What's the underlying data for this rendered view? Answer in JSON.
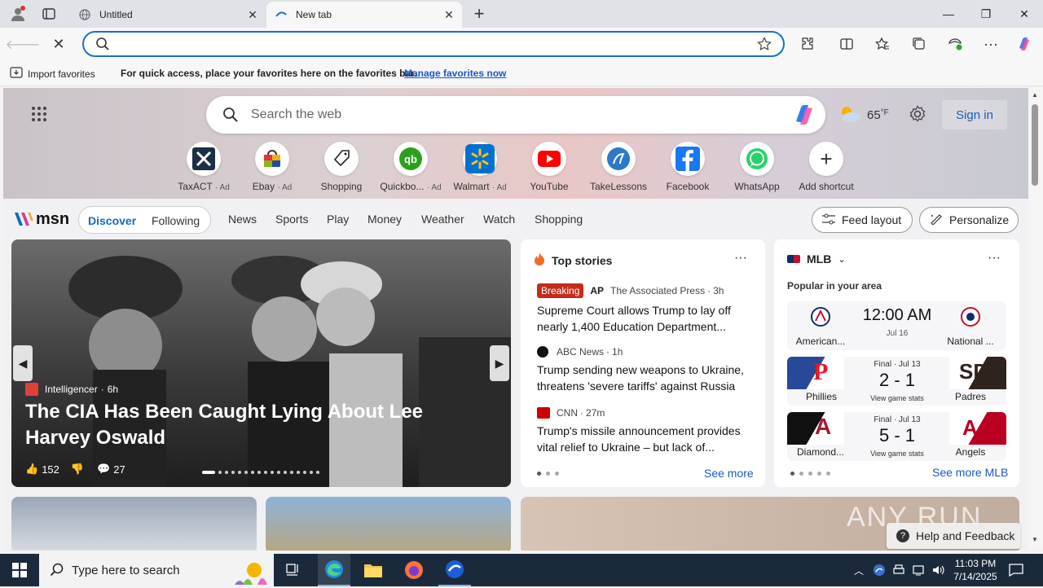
{
  "tabs": [
    {
      "label": "Untitled"
    },
    {
      "label": "New tab"
    }
  ],
  "favorites_bar": {
    "import_label": "Import favorites",
    "message": "For quick access, place your favorites here on the favorites bar.",
    "manage_link": "Manage favorites now"
  },
  "hero": {
    "search_placeholder": "Search the web",
    "temperature": "65",
    "temp_unit": "°F",
    "sign_in": "Sign in",
    "quick_links": [
      {
        "label": "TaxACT",
        "ad": "· Ad",
        "icon": "taxact-icon"
      },
      {
        "label": "Ebay",
        "ad": "· Ad",
        "icon": "ebay-icon"
      },
      {
        "label": "Shopping",
        "ad": "",
        "icon": "shopping-tag-icon"
      },
      {
        "label": "Quickbo...",
        "ad": "· Ad",
        "icon": "quickbooks-icon"
      },
      {
        "label": "Walmart",
        "ad": "· Ad",
        "icon": "walmart-icon"
      },
      {
        "label": "YouTube",
        "ad": "",
        "icon": "youtube-icon"
      },
      {
        "label": "TakeLessons",
        "ad": "",
        "icon": "takelessons-icon"
      },
      {
        "label": "Facebook",
        "ad": "",
        "icon": "facebook-icon"
      },
      {
        "label": "WhatsApp",
        "ad": "",
        "icon": "whatsapp-icon"
      },
      {
        "label": "Add shortcut",
        "ad": "",
        "icon": "plus-icon"
      }
    ]
  },
  "msn_nav": {
    "brand": "msn",
    "discover": "Discover",
    "following": "Following",
    "items": [
      "News",
      "Sports",
      "Play",
      "Money",
      "Weather",
      "Watch",
      "Shopping"
    ],
    "feed_layout": "Feed layout",
    "personalize": "Personalize"
  },
  "main_story": {
    "source": "Intelligencer",
    "age": "6h",
    "headline": "The CIA Has Been Caught Lying About Lee Harvey Oswald",
    "likes": "152",
    "comments": "27"
  },
  "top_stories": {
    "title": "Top stories",
    "items": [
      {
        "badge": "Breaking",
        "source": "The Associated Press",
        "age": "3h",
        "headline": "Supreme Court allows Trump to lay off nearly 1,400 Education Department..."
      },
      {
        "badge": "",
        "source": "ABC News",
        "age": "1h",
        "headline": "Trump sending new weapons to Ukraine, threatens 'severe tariffs' against Russia"
      },
      {
        "badge": "",
        "source": "CNN",
        "age": "27m",
        "headline": "Trump's missile announcement provides vital relief to Ukraine – but lack of..."
      }
    ],
    "see_more": "See more"
  },
  "mlb": {
    "title": "MLB",
    "subtitle": "Popular in your area",
    "games": [
      {
        "home": "American...",
        "away": "National ...",
        "time": "12:00 AM",
        "date": "Jul 16",
        "status": "",
        "score": ""
      },
      {
        "home": "Phillies",
        "away": "Padres",
        "time": "",
        "date": "",
        "status": "Final · Jul 13",
        "score": "2 - 1",
        "link": "View game stats"
      },
      {
        "home": "Diamond...",
        "away": "Angels",
        "time": "",
        "date": "",
        "status": "Final · Jul 13",
        "score": "5 - 1",
        "link": "View game stats"
      }
    ],
    "see_more": "See more MLB"
  },
  "help": "Help and Feedback",
  "watermark": "ANY RUN",
  "taskbar": {
    "search_placeholder": "Type here to search",
    "time": "11:03 PM",
    "date": "7/14/2025"
  },
  "colors": {
    "accent": "#1a6fd1",
    "msn_blue": "#0f6cbd",
    "taskbar": "#1b2a3b"
  }
}
